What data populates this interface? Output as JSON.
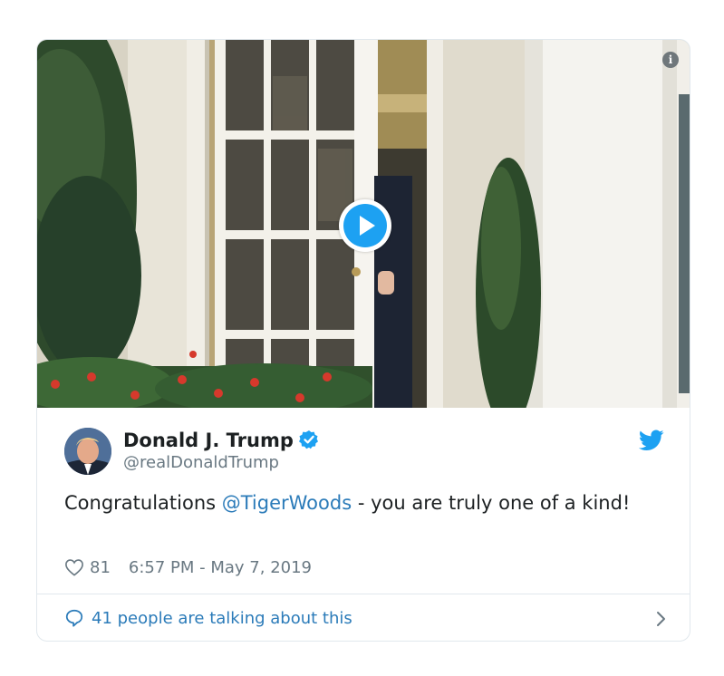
{
  "tweet": {
    "display_name": "Donald J. Trump",
    "handle": "@realDonaldTrump",
    "text_before": "Congratulations ",
    "mention": "@TigerWoods",
    "text_after": " - you are truly one of a kind!",
    "likes": "81",
    "timestamp": "6:57 PM - May 7, 2019",
    "talking": "41 people are talking about this"
  },
  "colors": {
    "twitter_blue": "#1da1f2",
    "link": "#2b7bb9",
    "secondary_text": "#697882"
  },
  "icons": {
    "play": "play-icon",
    "info": "info-icon",
    "verified": "verified-badge-icon",
    "bird": "twitter-bird-icon",
    "heart": "heart-icon",
    "bubble": "speech-bubble-icon",
    "chevron": "chevron-right-icon"
  }
}
